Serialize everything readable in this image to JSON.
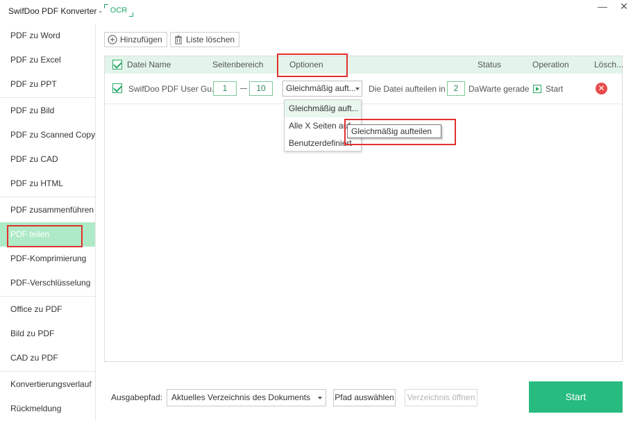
{
  "window": {
    "title": "SwifDoo PDF Konverter -",
    "ocr_badge": "OCR",
    "minimize_glyph": "—",
    "close_glyph": "✕"
  },
  "sidebar": {
    "items": [
      {
        "label": "PDF zu Word"
      },
      {
        "label": "PDF zu Excel"
      },
      {
        "label": "PDF zu PPT"
      },
      {
        "label": "PDF zu Bild"
      },
      {
        "label": "PDF zu Scanned Copy"
      },
      {
        "label": "PDF zu CAD"
      },
      {
        "label": "PDF zu HTML"
      },
      {
        "label": "PDF zusammenführen"
      },
      {
        "label": "PDF teilen"
      },
      {
        "label": "PDF-Komprimierung"
      },
      {
        "label": "PDF-Verschlüsselung"
      },
      {
        "label": "Office zu PDF"
      },
      {
        "label": "Bild zu PDF"
      },
      {
        "label": "CAD zu PDF"
      },
      {
        "label": "Konvertierungsverlauf"
      },
      {
        "label": "Rückmeldung"
      }
    ],
    "active_item": "PDF teilen"
  },
  "toolbar": {
    "add_label": "Hinzufügen",
    "clear_label": "Liste löschen"
  },
  "table": {
    "columns": {
      "name": "Datei Name",
      "range": "Seitenbereich",
      "options": "Optionen",
      "status": "Status",
      "operation": "Operation",
      "delete": "Lösch..."
    },
    "rows": [
      {
        "file_name": "SwifDoo PDF User Gu...",
        "range_from": "1",
        "range_to": "10",
        "option_value": "Gleichmäßig auft...",
        "split_prefix": "Die Datei aufteilen in",
        "split_count": "2",
        "status": "DaWarte gerade",
        "operation": "Start"
      }
    ]
  },
  "options_dropdown": {
    "items": [
      "Gleichmäßig auft...",
      "Alle X Seiten auf",
      "Benutzerdefiniert"
    ],
    "tooltip": "Gleichmäßig aufteilen"
  },
  "bottom": {
    "output_label": "Ausgabepfad:",
    "output_value": "Aktuelles Verzeichnis des Dokuments",
    "choose_path": "Pfad auswählen",
    "open_folder": "Verzeichnis öffnen",
    "start": "Start"
  },
  "colors": {
    "accent": "#27bb7f",
    "active_sidebar": "#aeeac7",
    "highlight": "#e0302e",
    "table_header": "#e3f5ea"
  }
}
